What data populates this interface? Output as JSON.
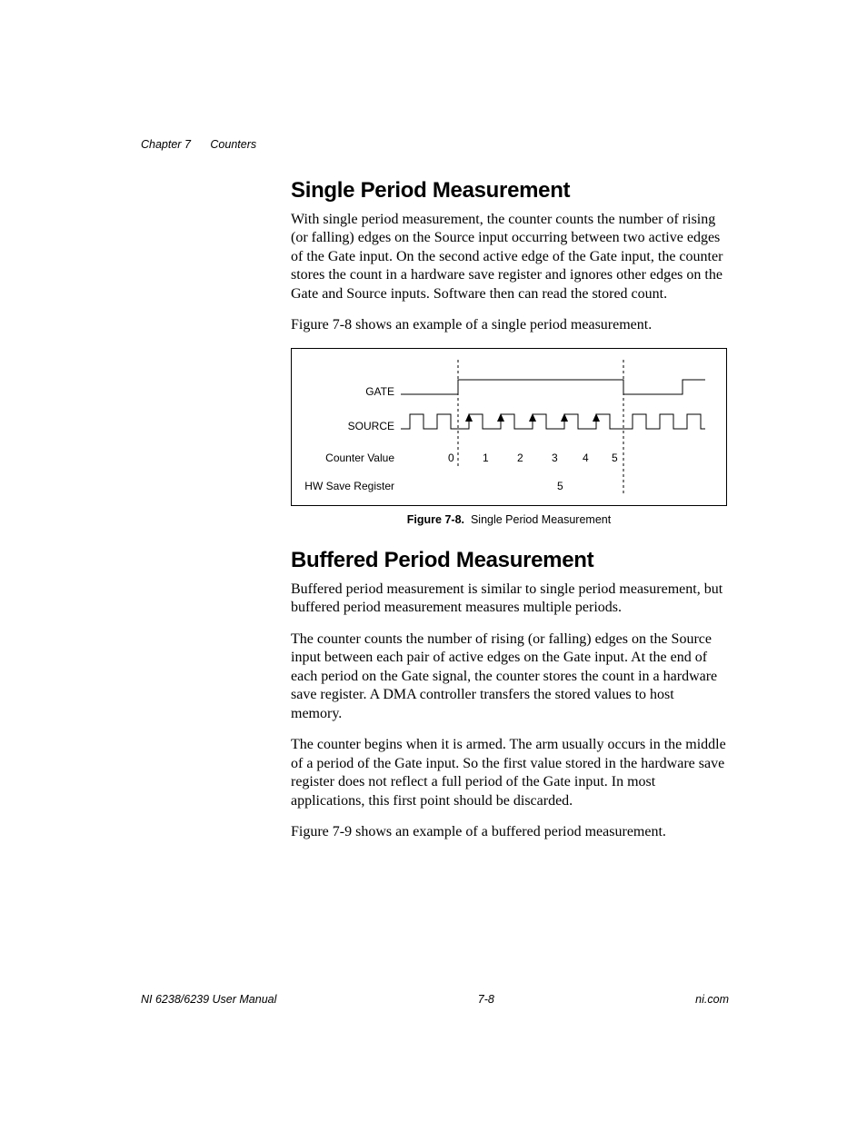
{
  "header": {
    "chapter": "Chapter 7",
    "topic": "Counters"
  },
  "section1": {
    "title": "Single Period Measurement",
    "para1": "With single period measurement, the counter counts the number of rising (or falling) edges on the Source input occurring between two active edges of the Gate input. On the second active edge of the Gate input, the counter stores the count in a hardware save register and ignores other edges on the Gate and Source inputs. Software then can read the stored count.",
    "para2": "Figure 7-8 shows an example of a single period measurement."
  },
  "figure": {
    "labels": {
      "gate": "GATE",
      "source": "SOURCE",
      "counter_value": "Counter Value",
      "hw_save": "HW Save Register"
    },
    "counter_values": [
      "0",
      "1",
      "2",
      "3",
      "4",
      "5"
    ],
    "hw_value": "5",
    "caption_num": "Figure 7-8.",
    "caption_text": "Single Period Measurement"
  },
  "section2": {
    "title": "Buffered Period Measurement",
    "para1": "Buffered period measurement is similar to single period measurement, but buffered period measurement measures multiple periods.",
    "para2": "The counter counts the number of rising (or falling) edges on the Source input between each pair of active edges on the Gate input. At the end of each period on the Gate signal, the counter stores the count in a hardware save register. A DMA controller transfers the stored values to host memory.",
    "para3": "The counter begins when it is armed. The arm usually occurs in the middle of a period of the Gate input. So the first value stored in the hardware save register does not reflect a full period of the Gate input. In most applications, this first point should be discarded.",
    "para4": "Figure 7-9 shows an example of a buffered period measurement."
  },
  "footer": {
    "left": "NI 6238/6239 User Manual",
    "center": "7-8",
    "right": "ni.com"
  }
}
